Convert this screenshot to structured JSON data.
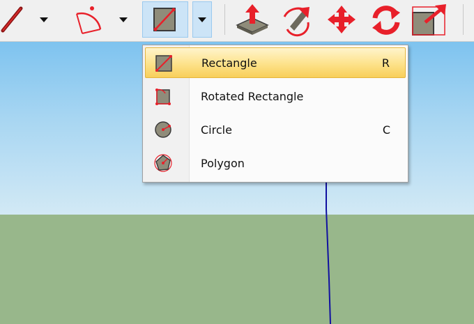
{
  "toolbar": {
    "tools": [
      {
        "name": "pencil-tool",
        "icon": "pencil-icon"
      },
      {
        "name": "arc-tool",
        "icon": "arc-icon"
      },
      {
        "name": "shape-tool",
        "icon": "rectangle-icon",
        "active": true
      },
      {
        "name": "push-pull-tool",
        "icon": "push-pull-icon"
      },
      {
        "name": "follow-me-tool",
        "icon": "follow-me-icon"
      },
      {
        "name": "move-tool",
        "icon": "move-icon"
      },
      {
        "name": "rotate-tool",
        "icon": "rotate-icon"
      },
      {
        "name": "scale-tool",
        "icon": "scale-icon"
      }
    ]
  },
  "menu": {
    "items": [
      {
        "label": "Rectangle",
        "shortcut": "R",
        "icon": "rectangle-icon",
        "selected": true
      },
      {
        "label": "Rotated Rectangle",
        "shortcut": "",
        "icon": "rotated-rectangle-icon",
        "selected": false
      },
      {
        "label": "Circle",
        "shortcut": "C",
        "icon": "circle-icon",
        "selected": false
      },
      {
        "label": "Polygon",
        "shortcut": "",
        "icon": "polygon-icon",
        "selected": false
      }
    ]
  },
  "colors": {
    "accent_red": "#e8202a",
    "selection_gold": "#f8cf5a",
    "sky": "#7ec3ef",
    "ground": "#98b78b",
    "axis_blue": "#1010a0"
  }
}
